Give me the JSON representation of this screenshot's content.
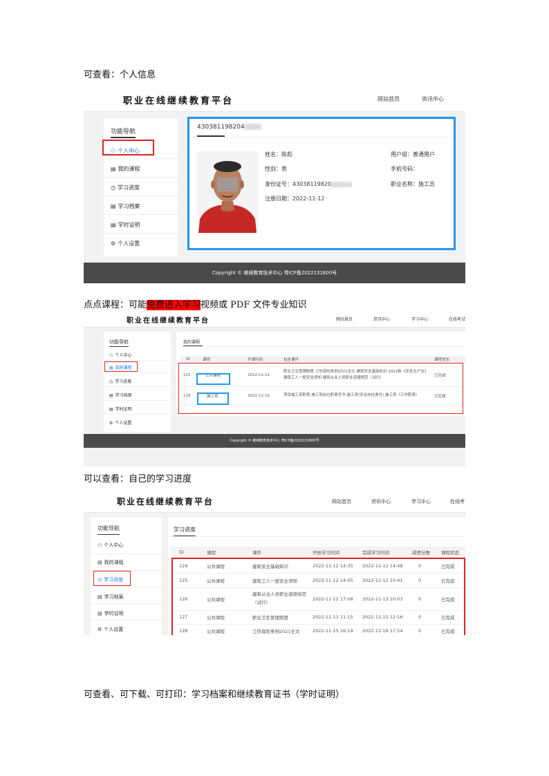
{
  "paragraphs": {
    "p1": "可查看：个人信息",
    "p2_pre": "点点课程：可能",
    "p2_hl": "免费进入学习",
    "p2_post": "视频或 PDF 文件专业知识",
    "p3": "可以查看：自己的学习进度",
    "p4": "可查看、可下载、可打印：学习档案和继续教育证书（学时证明）"
  },
  "shot1": {
    "brand": "职业在线继续教育平台",
    "nav": [
      "网站首页",
      "资讯中心"
    ],
    "sidebar_title": "功能导航",
    "sidebar_items": [
      {
        "icon": "user-icon",
        "glyph": "⚇",
        "label": "个人中心"
      },
      {
        "icon": "course-icon",
        "glyph": "▤",
        "label": "我的课程"
      },
      {
        "icon": "clock-icon",
        "glyph": "◷",
        "label": "学习进度"
      },
      {
        "icon": "archive-icon",
        "glyph": "▤",
        "label": "学习档案"
      },
      {
        "icon": "certificate-icon",
        "glyph": "▤",
        "label": "学时证明"
      },
      {
        "icon": "settings-icon",
        "glyph": "⚙",
        "label": "个人设置"
      }
    ],
    "profile_id": "430381198204",
    "name": "姓名：陈彪",
    "gender": "性别：男",
    "idcard": "身份证号：43038119820",
    "register": "注册日期：2022-11-12",
    "user_group": "用户组：普通用户",
    "phone": "手机号码：",
    "job": "职业名称：施工员",
    "footer": "Copyright © 继续教育技术中心 粤ICP备2022131800号"
  },
  "shot2": {
    "brand": "职业在线继续教育平台",
    "nav": [
      "网站首页",
      "资讯中心",
      "学习中心",
      "在线考试"
    ],
    "sidebar_title": "功能导航",
    "sidebar_items": [
      {
        "icon": "user-icon",
        "glyph": "⚇",
        "label": "个人中心"
      },
      {
        "icon": "course-icon",
        "glyph": "▤",
        "label": "我的课程"
      },
      {
        "icon": "clock-icon",
        "glyph": "◷",
        "label": "学习进度"
      },
      {
        "icon": "archive-icon",
        "glyph": "▤",
        "label": "学习档案"
      },
      {
        "icon": "certificate-icon",
        "glyph": "▤",
        "label": "学时证明"
      },
      {
        "icon": "settings-icon",
        "glyph": "⚙",
        "label": "个人设置"
      }
    ],
    "tab": "我的课程",
    "headers": [
      "ID",
      "课程",
      "开课时间",
      "包含课件",
      "课程状态"
    ],
    "rows": [
      {
        "id": "115",
        "course": "公共课程",
        "date": "2022-11-12",
        "content": "职业卫生管理制度 工伤保险条例2021全文 建筑安全基础知识 2022新《安全生产法》 建筑工人一般安全须知 建筑从业人员职业道德规范（试行）",
        "status": "已完成"
      },
      {
        "id": "116",
        "course": "施工员",
        "date": "2022-11-15",
        "content": "项目施工员职责 施工员岗位职责任书 施工员(安全岗位责任) 施工员（工作职责）",
        "status": "已完成"
      }
    ],
    "footer": "Copyright © 继续教育技术中心 粤ICP备2022131800号"
  },
  "shot3": {
    "brand": "职业在线继续教育平台",
    "nav": [
      "网站首页",
      "资讯中心",
      "学习中心",
      "在线考试"
    ],
    "sidebar_title": "功能导航",
    "sidebar_items": [
      {
        "icon": "user-icon",
        "glyph": "⚇",
        "label": "个人中心"
      },
      {
        "icon": "course-icon",
        "glyph": "▤",
        "label": "我的课程"
      },
      {
        "icon": "clock-icon",
        "glyph": "◷",
        "label": "学习进度"
      },
      {
        "icon": "archive-icon",
        "glyph": "▤",
        "label": "学习档案"
      },
      {
        "icon": "certificate-icon",
        "glyph": "▤",
        "label": "学时证明"
      },
      {
        "icon": "settings-icon",
        "glyph": "⚙",
        "label": "个人设置"
      }
    ],
    "tab": "学习进度",
    "headers": [
      "ID",
      "课程",
      "课件",
      "开始学习时间",
      "完成学习时间",
      "成绩分数",
      "课程状态"
    ],
    "rows": [
      {
        "id": "124",
        "course": "公共课程",
        "item": "建筑安全基础知识",
        "start": "2022-11-12 14:35",
        "end": "2022-11-12 14:48",
        "score": "0",
        "status": "已完成"
      },
      {
        "id": "125",
        "course": "公共课程",
        "item": "建筑工人一般安全须知",
        "start": "2022-11-12 14:45",
        "end": "2022-11-12 15:41",
        "score": "0",
        "status": "已完成"
      },
      {
        "id": "126",
        "course": "公共课程",
        "item": "建筑从业人员职业道德规范（试行）",
        "start": "2022-11-12 17:08",
        "end": "2022-11-13 10:03",
        "score": "0",
        "status": "已完成"
      },
      {
        "id": "127",
        "course": "公共课程",
        "item": "职业卫生管理制度",
        "start": "2022-11-13 11:15",
        "end": "2022-11-15 12:16",
        "score": "0",
        "status": "已完成"
      },
      {
        "id": "128",
        "course": "公共课程",
        "item": "工伤保险条例2021全文",
        "start": "2022-11-15 16:19",
        "end": "2022-11-16 17:54",
        "score": "0",
        "status": "已完成"
      }
    ]
  }
}
